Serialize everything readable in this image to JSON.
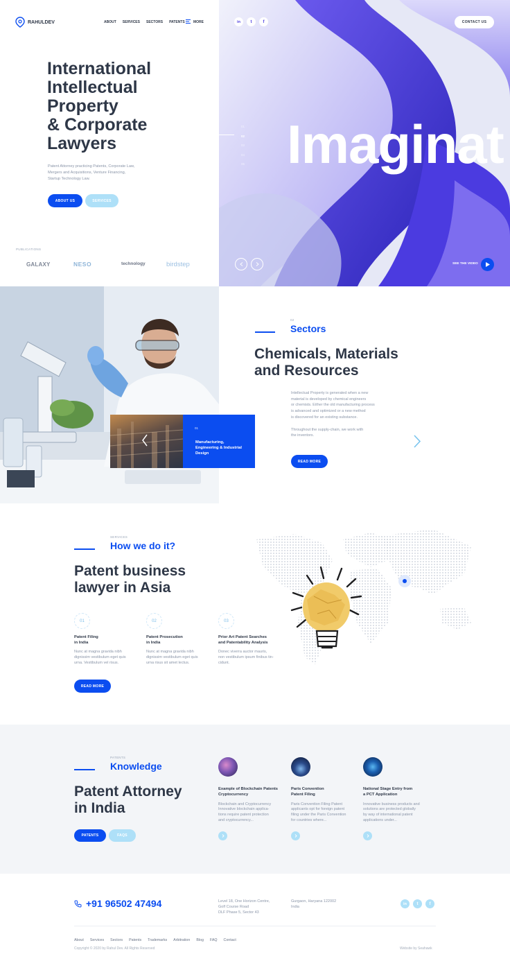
{
  "brand": {
    "name": "RAHULDEV"
  },
  "nav": {
    "items": [
      "ABOUT",
      "SERVICES",
      "SECTORS",
      "PATENTS"
    ],
    "more": "MORE",
    "contact": "CONTACT US"
  },
  "hero": {
    "title_lines": [
      "International",
      "Intellectual",
      "Property",
      "& Corporate",
      "Lawyers"
    ],
    "desc_lines": [
      "Patent Attorney practicing Patents, Corporate Law,",
      "Mergers and Acquisitions, Venture Financing,",
      "Startup Technology Law."
    ],
    "btn_about": "ABOUT US",
    "btn_services": "SERVICES",
    "publications_label": "PUBLICATIONS",
    "publications": [
      "GALAXY",
      "NESO",
      "technology",
      "birdstep"
    ],
    "slide_word": "Imaginat",
    "slides": [
      "01",
      "02",
      "03",
      "04",
      "05"
    ],
    "see_video": "SEE THE VIDEO"
  },
  "sectors": {
    "num": "02",
    "label": "Sectors",
    "title_lines": [
      "Chemicals, Materials",
      "and Resources"
    ],
    "p1": [
      "Intellectual Property is generated when a new",
      "material is developed by chemical engineers",
      "or chemists. Either the old manufacturing process",
      "is advanced and optimized or a new method",
      "is discovered for an existing substance."
    ],
    "p2": [
      "Throughout the supply-chain, we work with",
      "the inventors."
    ],
    "btn": "READ MORE",
    "card_num": "01",
    "card_title": [
      "Manufacturing,",
      "Engineering & Industrial",
      "Design"
    ]
  },
  "how": {
    "small": "SERVICES",
    "label": "How we do it?",
    "title_lines": [
      "Patent business",
      "lawyer in Asia"
    ],
    "steps": [
      {
        "num": "01",
        "title": [
          "Patent Filing",
          "in India"
        ],
        "text": [
          "Nunc at magna gravida nibh",
          "dignissim vestibulum eget quis",
          "urna. Vestibulum vel risus."
        ]
      },
      {
        "num": "02",
        "title": [
          "Patent Prosecution",
          "in India"
        ],
        "text": [
          "Nunc at magna gravida nibh",
          "dignissim vestibulum eget quis",
          "urna risus sit amet lectus."
        ]
      },
      {
        "num": "03",
        "title": [
          "Prior Art Patent Searches",
          "and Patentability Analysis"
        ],
        "text": [
          "Donec viverra auctor mauris,",
          "non vestibulum ipsum finibus tin-",
          "cidunt."
        ]
      }
    ],
    "btn": "READ MORE"
  },
  "knowledge": {
    "small": "PATENTS",
    "label": "Knowledge",
    "title_lines": [
      "Patent Attorney",
      "in India"
    ],
    "btn_patents": "PATENTS",
    "btn_faqs": "FAQS",
    "articles": [
      {
        "title": [
          "Example of Blockchain Patents",
          "Cryptocurrency"
        ],
        "text": [
          "Blockchain and Cryptocurrency",
          "Innovative blockchain applica-",
          "tions require patent protection",
          "and cryptocurrency..."
        ]
      },
      {
        "title": [
          "Paris Convention",
          "Patent Filing"
        ],
        "text": [
          "Paris Convention Filing Patent",
          "applicants opt for foreign patent",
          "filing under the Paris Convention",
          "for countries where..."
        ]
      },
      {
        "title": [
          "National Stage Entry from",
          "a PCT Application"
        ],
        "text": [
          "Innovative business products and",
          "solutions are protected globally",
          "by way of international patent",
          "applications under..."
        ]
      }
    ]
  },
  "footer": {
    "phone": "+91 96502 47494",
    "address1": [
      "Level 18, One Horizon Centre,",
      "Golf Course Road",
      "DLF Phase 5, Sector 43"
    ],
    "address2": [
      "Gurgaon, Haryana 122002",
      "India"
    ],
    "links": [
      "About",
      "Services",
      "Sectors",
      "Patents",
      "Trademarks",
      "Arbitration",
      "Blog",
      "FAQ",
      "Contact"
    ],
    "copyright": "Copyright © 2020 by Rahul Dev. All Rights Reserved",
    "credit": "Website by Seahawk"
  },
  "colors": {
    "accent": "#0b4df0",
    "light_accent": "#aee0f8",
    "dark_text": "#2e3747",
    "hero_purple": "#5b4be8"
  }
}
